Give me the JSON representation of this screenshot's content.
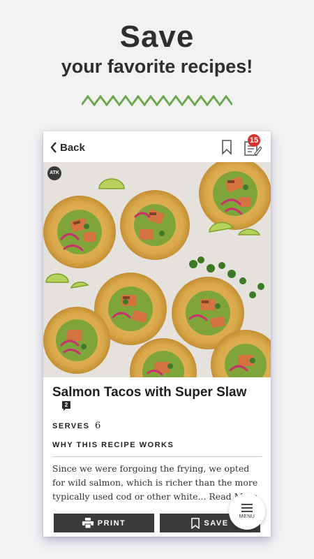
{
  "promo": {
    "title": "Save",
    "subtitle": "your favorite recipes!"
  },
  "colors": {
    "accent_green": "#6aa84f",
    "badge_red": "#d6332a",
    "button_dark": "#3b3b3b"
  },
  "topbar": {
    "back_label": "Back",
    "bookmark_icon": "bookmark-icon",
    "list_icon": "shopping-list-icon",
    "list_badge_count": "15"
  },
  "hero": {
    "logo_text": "ATK",
    "image_subject": "salmon tacos"
  },
  "recipe": {
    "title": "Salmon Tacos with Super Slaw",
    "comment_count": "2",
    "serves_label": "SERVES",
    "serves_value": "6",
    "why_heading": "WHY THIS RECIPE WORKS",
    "why_body": "Since we were forgoing the frying, we opted for wild salmon, which is richer than the more typically used cod or other white... Read More"
  },
  "actions": {
    "print_label": "PRINT",
    "save_label": "SAVE"
  },
  "menu": {
    "label": "MENU"
  }
}
